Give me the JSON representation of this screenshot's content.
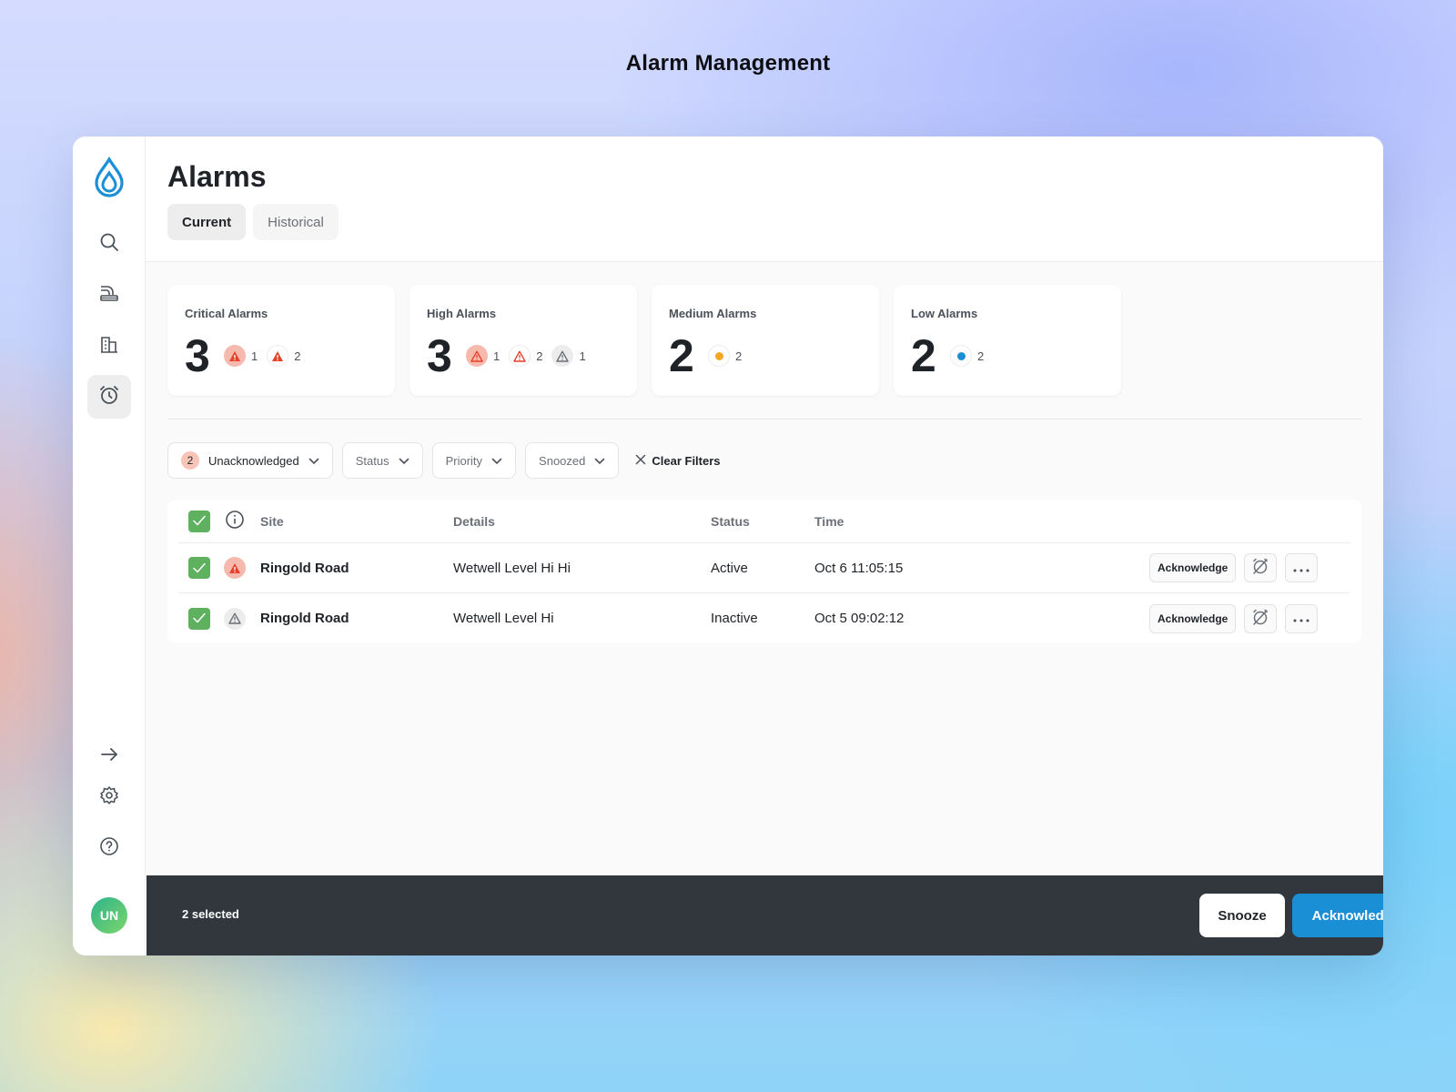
{
  "page_heading": "Alarm Management",
  "sidebar": {
    "items": [
      {
        "icon": "search-icon"
      },
      {
        "icon": "pipeline-icon"
      },
      {
        "icon": "building-icon"
      },
      {
        "icon": "alarm-clock-icon",
        "active": true
      }
    ],
    "bottom_items": [
      {
        "icon": "arrow-right-icon"
      },
      {
        "icon": "gear-icon"
      },
      {
        "icon": "help-icon"
      }
    ],
    "avatar_initials": "UN"
  },
  "header": {
    "title": "Alarms",
    "tabs": [
      {
        "label": "Current",
        "active": true
      },
      {
        "label": "Historical",
        "active": false
      }
    ]
  },
  "summary_cards": [
    {
      "label": "Critical Alarms",
      "value": "3",
      "badges": [
        {
          "icon": "warning-icon",
          "style": "crit-solid",
          "count": "1"
        },
        {
          "icon": "warning-icon",
          "style": "crit-line",
          "count": "2"
        }
      ]
    },
    {
      "label": "High Alarms",
      "value": "3",
      "badges": [
        {
          "icon": "warning-outline-icon",
          "style": "crit-solid",
          "count": "1"
        },
        {
          "icon": "warning-outline-icon",
          "style": "crit-line",
          "count": "2"
        },
        {
          "icon": "warning-outline-icon",
          "style": "grey",
          "count": "1"
        }
      ]
    },
    {
      "label": "Medium Alarms",
      "value": "2",
      "badges": [
        {
          "icon": "dot-icon",
          "style": "white",
          "color": "#f5a623",
          "count": "2"
        }
      ]
    },
    {
      "label": "Low Alarms",
      "value": "2",
      "badges": [
        {
          "icon": "dot-icon",
          "style": "white",
          "color": "#1a8fd6",
          "count": "2"
        }
      ]
    }
  ],
  "filters": {
    "unacknowledged": {
      "count": "2",
      "label": "Unacknowledged"
    },
    "status": "Status",
    "priority": "Priority",
    "snoozed": "Snoozed",
    "clear": "Clear Filters"
  },
  "table": {
    "columns": {
      "site": "Site",
      "details": "Details",
      "status": "Status",
      "time": "Time"
    },
    "rows": [
      {
        "site": "Ringold Road",
        "details": "Wetwell Level Hi Hi",
        "status": "Active",
        "time": "Oct 6 11:05:15",
        "severity": "critical",
        "ack_label": "Acknowledge"
      },
      {
        "site": "Ringold Road",
        "details": "Wetwell Level Hi",
        "status": "Inactive",
        "time": "Oct 5 09:02:12",
        "severity": "inactive",
        "ack_label": "Acknowledge"
      }
    ]
  },
  "bottom_bar": {
    "selected_text": "2 selected",
    "snooze_label": "Snooze",
    "acknowledge_label": "Acknowledge"
  },
  "colors": {
    "accent": "#1a8fd6",
    "critical": "#e8412a",
    "checkbox": "#5fb160",
    "bottom_bar": "#32373d"
  }
}
